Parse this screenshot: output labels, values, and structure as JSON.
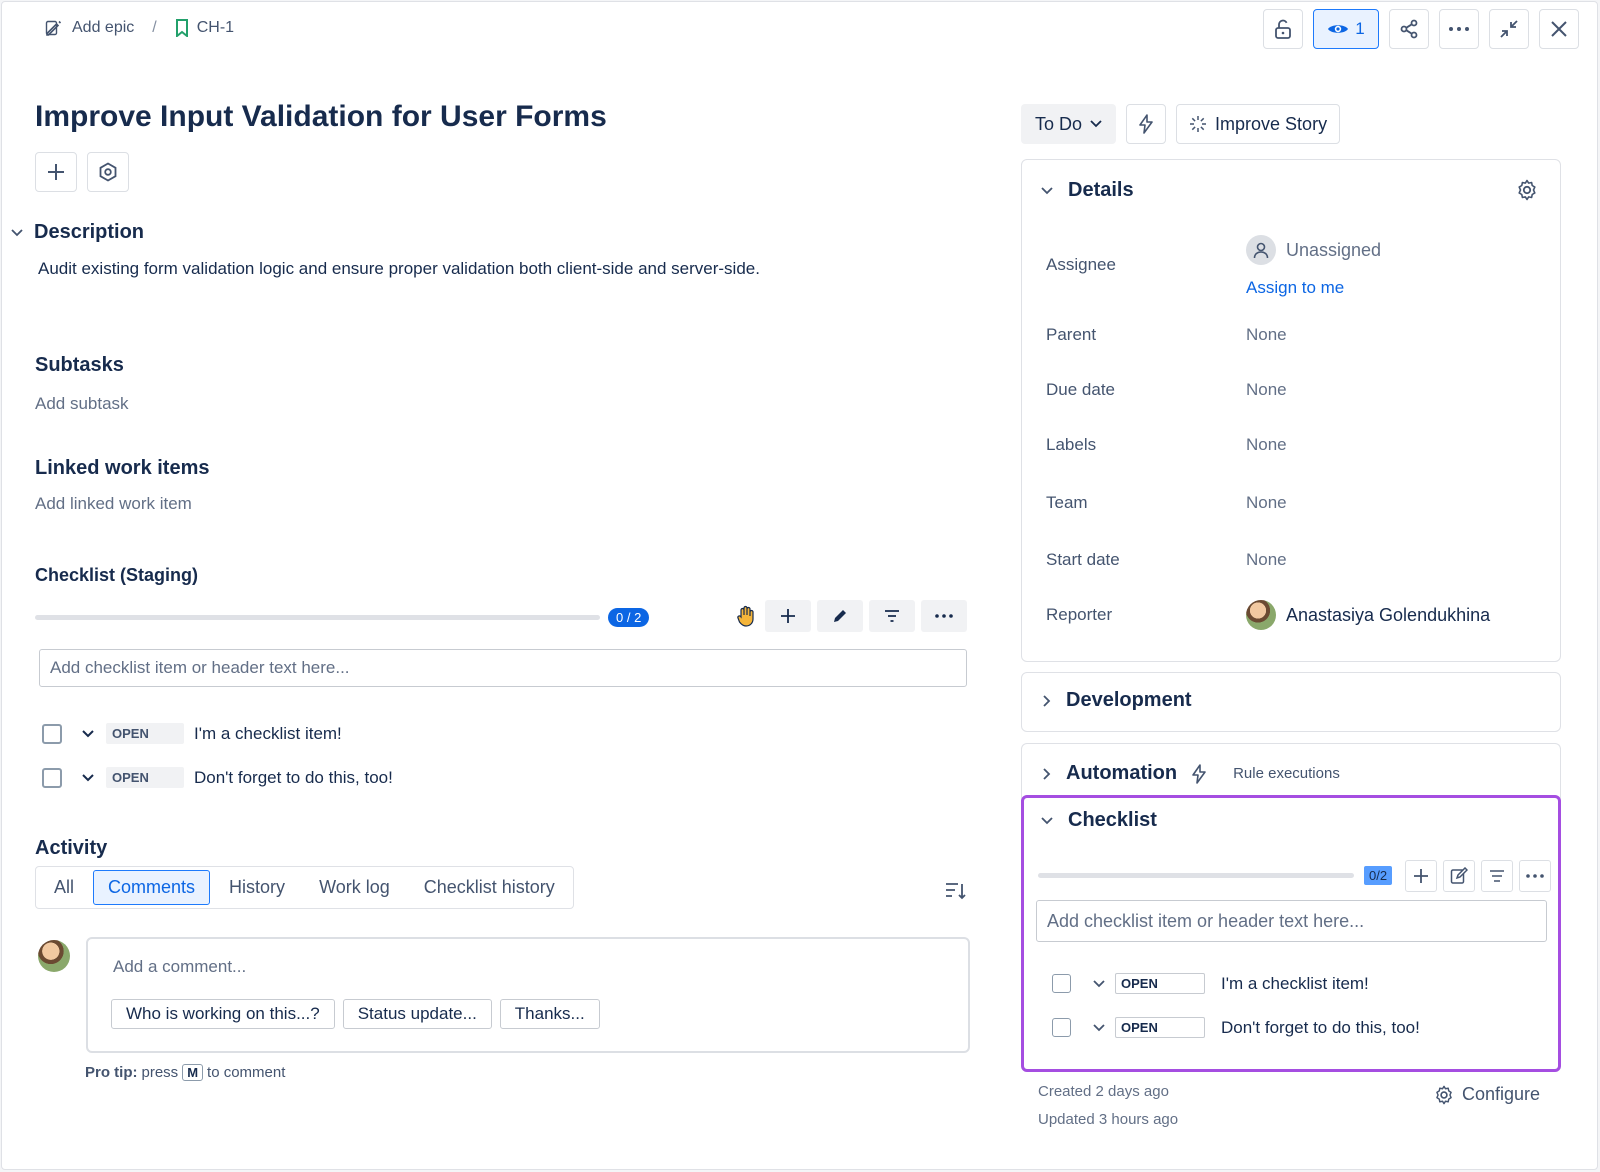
{
  "breadcrumb": {
    "add_epic": "Add epic",
    "separator": "/",
    "issue_key": "CH-1"
  },
  "top_actions": {
    "watch_count": "1"
  },
  "issue": {
    "title": "Improve Input Validation for User Forms",
    "description_heading": "Description",
    "description": "Audit existing form validation logic and ensure proper validation both client-side and server-side."
  },
  "subtasks": {
    "heading": "Subtasks",
    "add": "Add subtask"
  },
  "linked": {
    "heading": "Linked work items",
    "add": "Add linked work item"
  },
  "checklist_staging": {
    "heading": "Checklist (Staging)",
    "progress_label": "0 / 2",
    "progress_fraction": 0,
    "placeholder": "Add checklist item or header text here...",
    "items": [
      {
        "status": "OPEN",
        "text": "I'm a checklist item!"
      },
      {
        "status": "OPEN",
        "text": "Don't forget to do this, too!"
      }
    ]
  },
  "activity": {
    "heading": "Activity",
    "tabs": [
      "All",
      "Comments",
      "History",
      "Work log",
      "Checklist history"
    ],
    "active_tab": "Comments",
    "comment_placeholder": "Add a comment...",
    "quick_replies": [
      "Who is working on this...?",
      "Status update...",
      "Thanks..."
    ],
    "pro_tip_label": "Pro tip:",
    "pro_tip_pre": "press",
    "pro_tip_key": "M",
    "pro_tip_post": "to comment"
  },
  "status_bar": {
    "status": "To Do",
    "improve": "Improve Story"
  },
  "details": {
    "title": "Details",
    "assignee_label": "Assignee",
    "assignee_value": "Unassigned",
    "assign_to_me": "Assign to me",
    "parent_label": "Parent",
    "parent_value": "None",
    "due_label": "Due date",
    "due_value": "None",
    "labels_label": "Labels",
    "labels_value": "None",
    "team_label": "Team",
    "team_value": "None",
    "start_label": "Start date",
    "start_value": "None",
    "reporter_label": "Reporter",
    "reporter_value": "Anastasiya Golendukhina"
  },
  "development": {
    "title": "Development"
  },
  "automation": {
    "title": "Automation",
    "rule_executions": "Rule executions"
  },
  "checklist_panel": {
    "title": "Checklist",
    "progress_label": "0/2",
    "progress_fraction": 0,
    "placeholder": "Add checklist item or header text here...",
    "items": [
      {
        "status": "OPEN",
        "text": "I'm a checklist item!"
      },
      {
        "status": "OPEN",
        "text": "Don't forget to do this, too!"
      }
    ],
    "highlight_color": "#a54ee1"
  },
  "footer": {
    "created": "Created 2 days ago",
    "updated": "Updated 3 hours ago",
    "configure": "Configure"
  }
}
